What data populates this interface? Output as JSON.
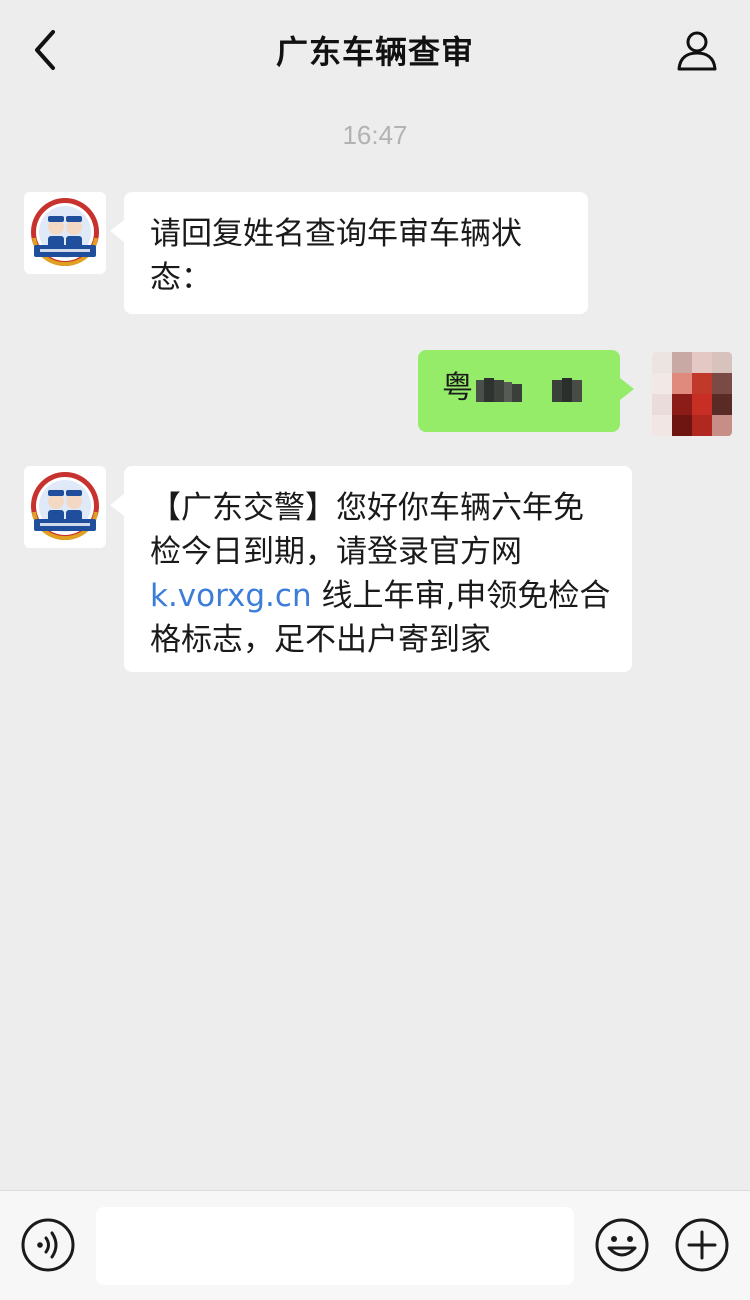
{
  "header": {
    "title": "广东车辆查审"
  },
  "timestamp": "16:47",
  "messages": [
    {
      "sender": "official",
      "text": "请回复姓名查询年审车辆状态："
    },
    {
      "sender": "me",
      "text_prefix": "粤"
    },
    {
      "sender": "official",
      "text_part1": "【广东交警】您好你车辆六年免检今日到期，请登录官方网",
      "link": "k.vorxg.cn",
      "text_part2": " 线上年审,申领免检合格标志，足不出户寄到家"
    }
  ],
  "icons": {
    "back": "chevron-left-icon",
    "profile": "person-icon",
    "voice": "voice-icon",
    "emoji": "smiley-icon",
    "plus": "plus-icon"
  },
  "colors": {
    "background": "#ededed",
    "my_bubble": "#95ec69",
    "other_bubble": "#ffffff",
    "link": "#3b7dd8",
    "avatar_red": "#c8322e",
    "avatar_blue": "#1f4e9c"
  }
}
